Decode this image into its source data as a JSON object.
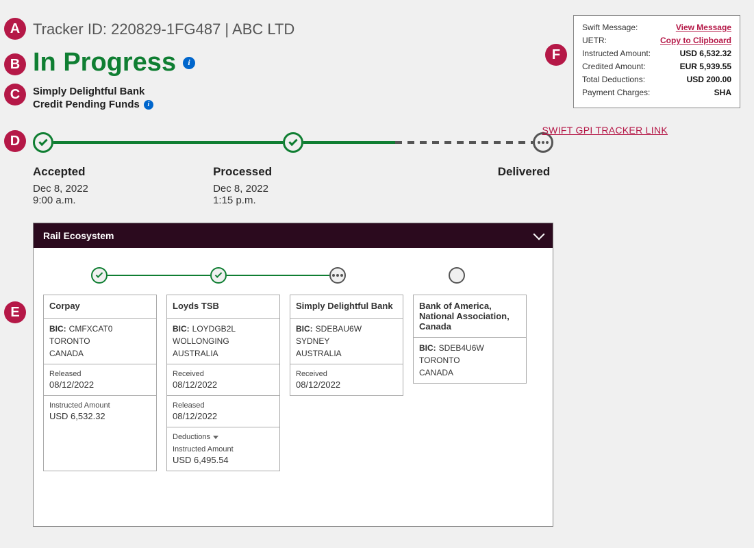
{
  "badges": {
    "a": "A",
    "b": "B",
    "c": "C",
    "d": "D",
    "e": "E",
    "f": "F"
  },
  "header": {
    "tracker_id": "Tracker ID: 220829-1FG487 | ABC LTD",
    "status": "In Progress",
    "bank": "Simply Delightful Bank",
    "credit_pending": "Credit Pending Funds"
  },
  "timeline": {
    "accepted": {
      "label": "Accepted",
      "date": "Dec 8, 2022",
      "time": "9:00 a.m."
    },
    "processed": {
      "label": "Processed",
      "date": "Dec 8, 2022",
      "time": "1:15 p.m."
    },
    "delivered": {
      "label": "Delivered"
    }
  },
  "rail": {
    "title": "Rail Ecosystem",
    "cards": {
      "corpay": {
        "name": "Corpay",
        "bic_label": "BIC:",
        "bic": "CMFXCAT0",
        "city": "TORONTO",
        "country": "CANADA",
        "released_label": "Released",
        "released": "08/12/2022",
        "inst_label": "Instructed Amount",
        "inst": "USD 6,532.32"
      },
      "loyds": {
        "name": "Loyds TSB",
        "bic_label": "BIC:",
        "bic": "LOYDGB2L",
        "city": "WOLLONGING",
        "country": "AUSTRALIA",
        "received_label": "Received",
        "received": "08/12/2022",
        "released_label": "Released",
        "released": "08/12/2022",
        "ded_label": "Deductions",
        "inst_label": "Instructed Amount",
        "inst": "USD 6,495.54"
      },
      "sdb": {
        "name": "Simply Delightful Bank",
        "bic_label": "BIC:",
        "bic": "SDEBAU6W",
        "city": "SYDNEY",
        "country": "AUSTRALIA",
        "received_label": "Received",
        "received": "08/12/2022"
      },
      "boa": {
        "name": "Bank of America, National Association, Canada",
        "bic_label": "BIC:",
        "bic": "SDEB4U6W",
        "city": "TORONTO",
        "country": "CANADA"
      }
    }
  },
  "infobox": {
    "swift_label": "Swift Message:",
    "swift_link": "View Message",
    "uetr_label": "UETR:",
    "uetr_link": "Copy to Clipboard",
    "inst_label": "Instructed Amount:",
    "inst": "USD 6,532.32",
    "cred_label": "Credited Amount:",
    "cred": "EUR 5,939.55",
    "ded_label": "Total Deductions:",
    "ded": "USD 200.00",
    "pay_label": "Payment Charges:",
    "pay": "SHA"
  },
  "gpi_link": "SWIFT GPI TRACKER LINK"
}
